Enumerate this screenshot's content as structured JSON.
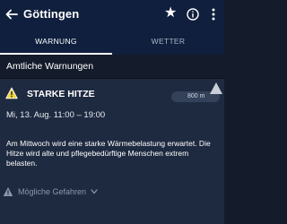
{
  "header": {
    "title": "Göttingen",
    "star_icon": "star-icon",
    "info_icon": "info-icon",
    "more_icon": "more-vert-icon",
    "back_icon": "arrow-back-icon"
  },
  "tabs": [
    {
      "label": "WARNUNG",
      "active": true
    },
    {
      "label": "WETTER",
      "active": false
    }
  ],
  "section": {
    "title": "Amtliche Warnungen"
  },
  "warning": {
    "title": "STARKE HITZE",
    "icon": "warning-icon",
    "altitude": "800 m",
    "altitude_icon": "mountain-triangle-icon",
    "date": "Mi, 13. Aug. 11:00 – 19:00",
    "description": "Am Mittwoch wird eine starke Wärmebelastung erwartet. Die Hitze wird alte und pflegebedürftige Menschen extrem belasten.",
    "hazards_label": "Mögliche Gefahren",
    "hazards_icon": "warning-outline-icon",
    "chevron_icon": "chevron-down-icon"
  },
  "colors": {
    "appbar": "#0f1f3d",
    "background": "#141b2a",
    "card": "#1e2a40",
    "muted": "#8d97ac"
  }
}
